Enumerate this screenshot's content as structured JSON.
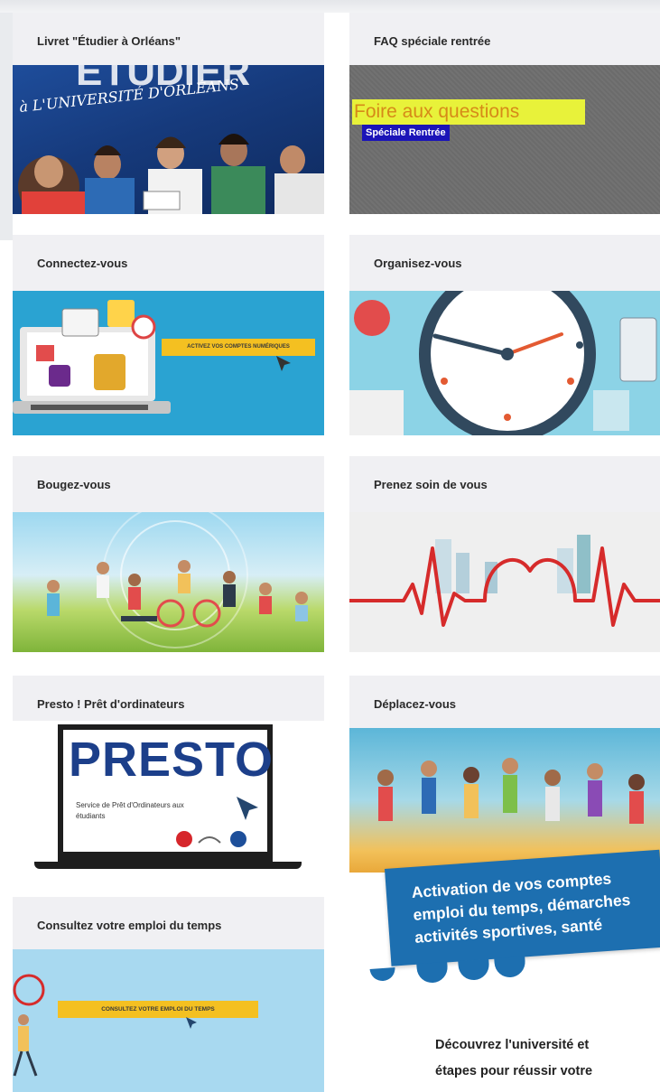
{
  "cards": [
    {
      "title": "Livret \"Étudier à Orléans\"",
      "overlay": "à L'UNIVERSITÉ D'ORLÉANS",
      "overlay_top": "ÉTUDIER"
    },
    {
      "title": "FAQ spéciale rentrée",
      "overlay": "Foire aux questions",
      "overlay_sub": "Spéciale Rentrée"
    },
    {
      "title": "Connectez-vous",
      "overlay": "ACTIVEZ VOS COMPTES NUMÉRIQUES"
    },
    {
      "title": "Organisez-vous"
    },
    {
      "title": "Bougez-vous"
    },
    {
      "title": "Prenez soin de vous"
    },
    {
      "title": "Presto ! Prêt d'ordinateurs",
      "overlay": "PRESTO",
      "overlay_sub": "Service de Prêt d'Ordinateurs aux étudiants"
    },
    {
      "title": "Déplacez-vous"
    },
    {
      "title": "Consultez votre emploi du temps",
      "overlay": "CONSULTEZ VOTRE EMPLOI DU TEMPS"
    }
  ],
  "banner": {
    "line1": "Activation de vos comptes",
    "line2": "emploi du temps, démarches",
    "line3": "activités sportives, santé"
  },
  "discover": {
    "line1": "Découvrez l'université et",
    "line2": "étapes pour réussir votre"
  },
  "colors": {
    "banner": "#1d6fb0",
    "accent_yellow": "#f4c021",
    "card_header": "#f0f0f3"
  }
}
